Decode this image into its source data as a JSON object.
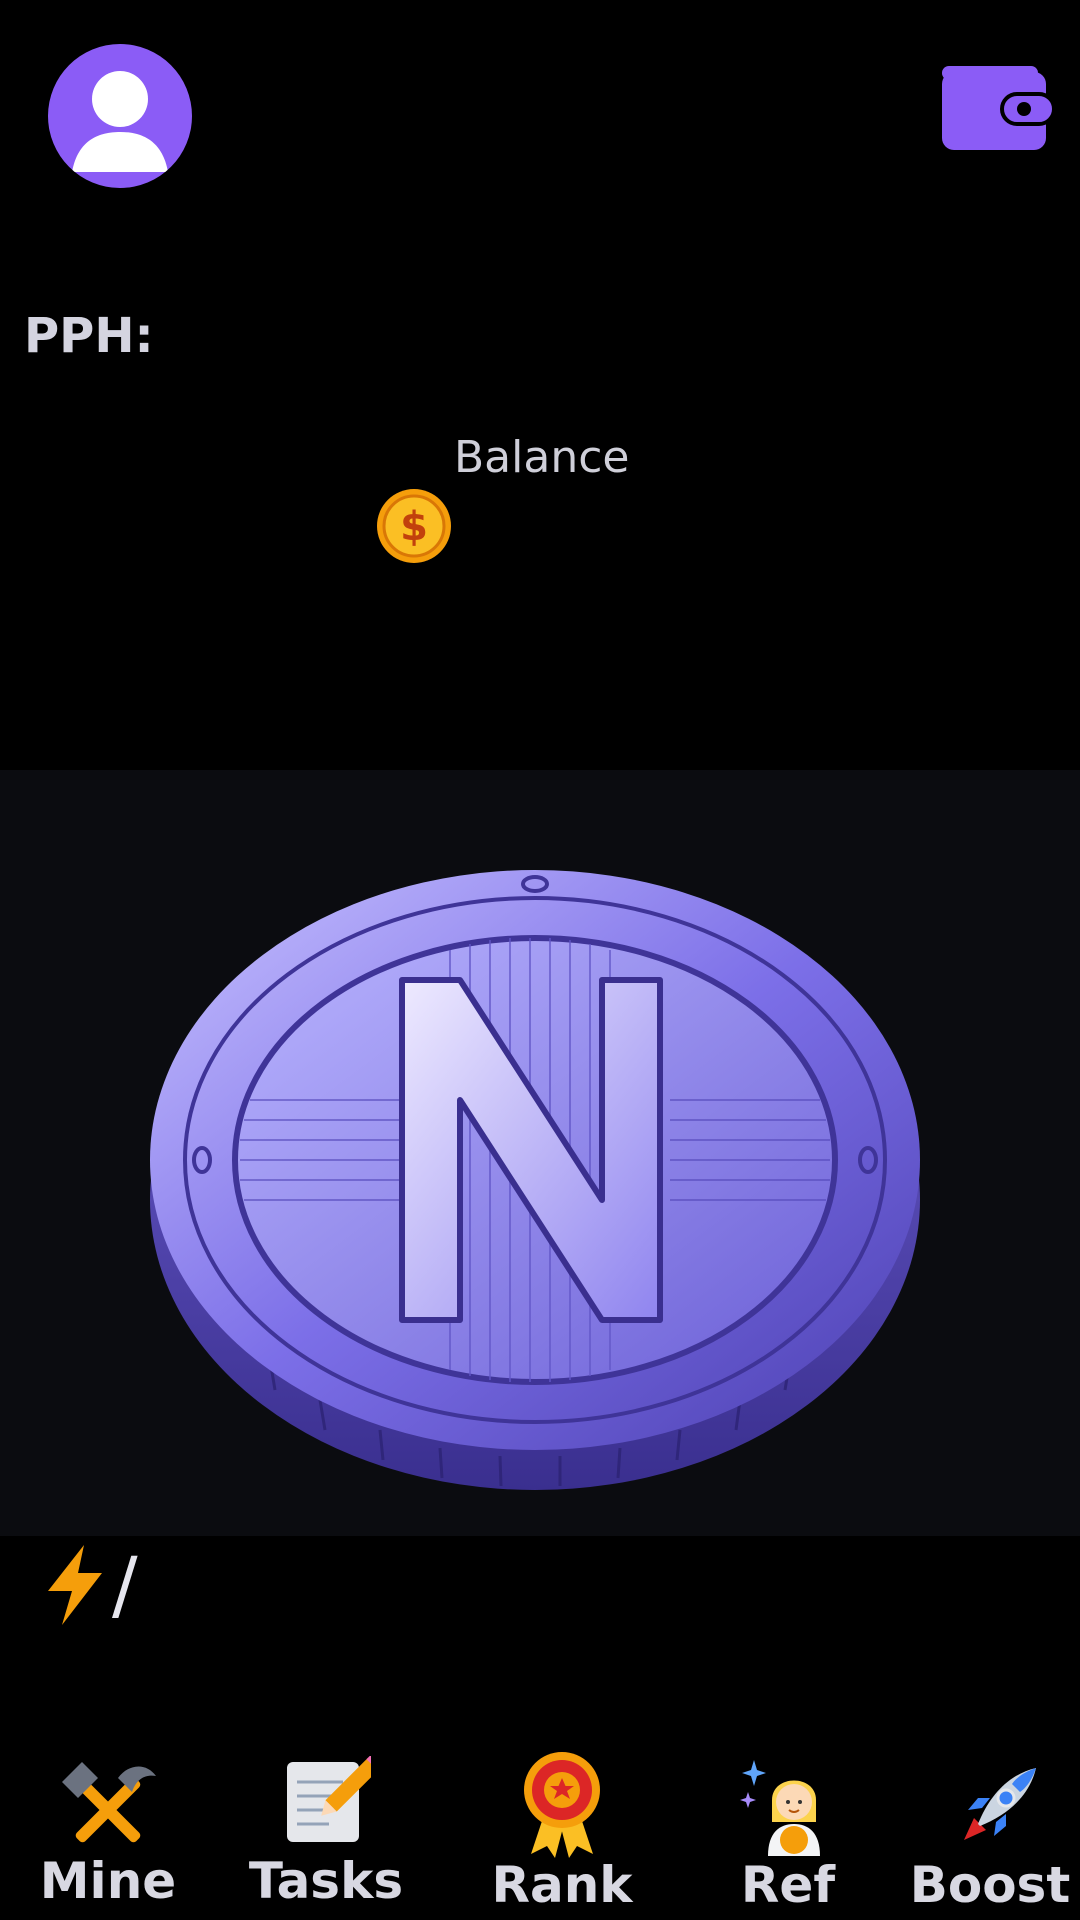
{
  "header": {
    "avatar_icon": "user-icon",
    "wallet_icon": "wallet-icon"
  },
  "stats": {
    "pph_label": "PPH:",
    "balance_label": "Balance",
    "balance_icon": "dollar-coin-icon"
  },
  "tap": {
    "coin_icon": "n-coin-icon",
    "coin_letter": "N"
  },
  "energy": {
    "icon": "lightning-icon",
    "separator": "/"
  },
  "nav": {
    "items": [
      {
        "label": "Mine",
        "icon": "hammer-pick-icon"
      },
      {
        "label": "Tasks",
        "icon": "memo-pencil-icon"
      },
      {
        "label": "Rank",
        "icon": "medal-icon"
      },
      {
        "label": "Ref",
        "icon": "astronaut-icon"
      },
      {
        "label": "Boost",
        "icon": "rocket-icon"
      }
    ]
  },
  "colors": {
    "accent": "#8b5cf6",
    "background": "#000000",
    "tap_area": "#0b0c10",
    "coin_gold": "#f59e0b"
  }
}
